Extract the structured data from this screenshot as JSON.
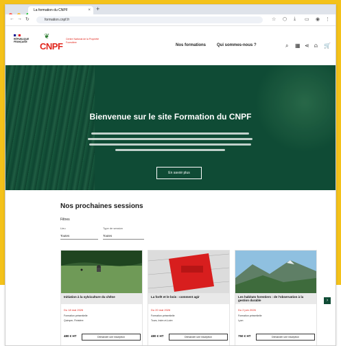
{
  "browser": {
    "tab_title": "La formation du CNPF",
    "new_tab": "+",
    "tab_close": "×",
    "url": "formation.cnpf.fr",
    "dot_colors": [
      "#ff5f57",
      "#febc2e",
      "#28c840"
    ]
  },
  "header": {
    "republic_text": [
      "RÉPUBLIQUE",
      "FRANÇAISE"
    ],
    "logo_text": "CNPF",
    "logo_subtitle": "Centre National de la Propriété Forestière",
    "nav": [
      "Nos formations",
      "Qui sommes-nous ?"
    ]
  },
  "hero": {
    "title": "Bienvenue sur le site Formation du CNPF",
    "button_label": "En savoir plus"
  },
  "sessions": {
    "title": "Nos prochaines sessions",
    "filters_label": "Filtres",
    "filter_labels": [
      "Lieu",
      "Type de session"
    ],
    "filter_values": [
      "Toutes",
      "Toutes"
    ],
    "cards": [
      {
        "caption": "Initiation à la sylviculture du chêne",
        "date": "Du 18 mai 2026",
        "meta": [
          "Formation présentielle",
          "Quimper, Finistère"
        ],
        "price": "480 € HT",
        "button": "Demander une inscription"
      },
      {
        "caption": "La forêt et le bois : comment agir",
        "date": "Du 20 mai 2026",
        "meta": [
          "Formation présentielle",
          "Tours, Indre-et-Loire"
        ],
        "price": "480 € HT",
        "button": "Demander une inscription"
      },
      {
        "caption": "Les habitats forestiers : de l'observation à la gestion durable",
        "date": "Du 2 juin 2026",
        "meta": [
          "Formation présentielle",
          "Lyon"
        ],
        "price": "750 € HT",
        "button": "Demander une inscription"
      }
    ],
    "next_arrow": "›"
  }
}
